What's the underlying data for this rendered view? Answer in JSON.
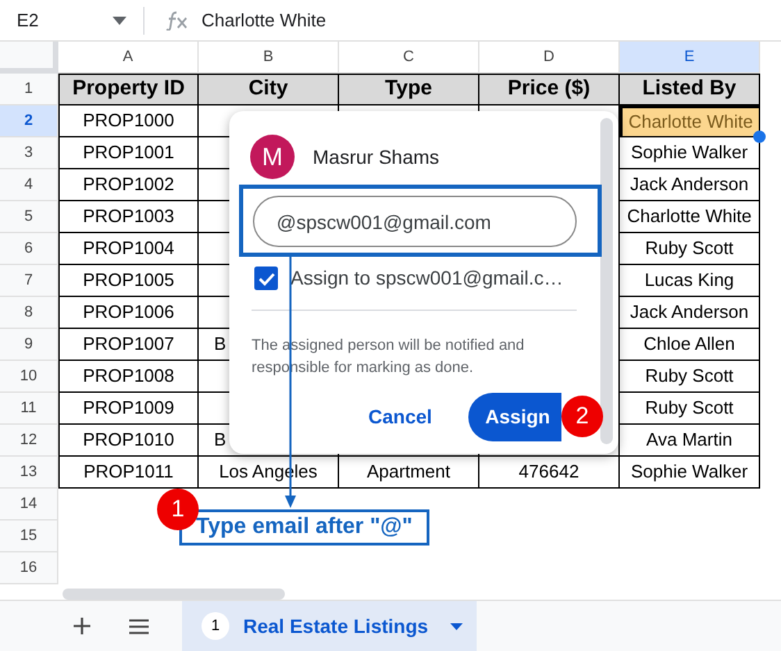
{
  "formula_bar": {
    "cell_reference": "E2",
    "formula": "Charlotte White"
  },
  "columns": [
    {
      "label": "A",
      "selected": false
    },
    {
      "label": "B",
      "selected": false
    },
    {
      "label": "C",
      "selected": false
    },
    {
      "label": "D",
      "selected": false
    },
    {
      "label": "E",
      "selected": true
    }
  ],
  "rows": [
    {
      "number": "1",
      "selected": false,
      "header": true,
      "cells": {
        "A": "Property ID",
        "B": "City",
        "C": "Type",
        "D": "Price ($)",
        "E": "Listed By"
      }
    },
    {
      "number": "2",
      "selected": true,
      "cells": {
        "A": "PROP1000",
        "E": "Charlotte White"
      }
    },
    {
      "number": "3",
      "selected": false,
      "cells": {
        "A": "PROP1001",
        "E": "Sophie Walker"
      }
    },
    {
      "number": "4",
      "selected": false,
      "cells": {
        "A": "PROP1002",
        "E": "Jack Anderson"
      }
    },
    {
      "number": "5",
      "selected": false,
      "cells": {
        "A": "PROP1003",
        "E": "Charlotte White"
      }
    },
    {
      "number": "6",
      "selected": false,
      "cells": {
        "A": "PROP1004",
        "E": "Ruby Scott"
      }
    },
    {
      "number": "7",
      "selected": false,
      "cells": {
        "A": "PROP1005",
        "E": "Lucas King"
      }
    },
    {
      "number": "8",
      "selected": false,
      "cells": {
        "A": "PROP1006",
        "E": "Jack Anderson"
      }
    },
    {
      "number": "9",
      "selected": false,
      "cells": {
        "A": "PROP1007",
        "B": "B",
        "E": "Chloe Allen"
      }
    },
    {
      "number": "10",
      "selected": false,
      "cells": {
        "A": "PROP1008",
        "E": "Ruby Scott"
      }
    },
    {
      "number": "11",
      "selected": false,
      "cells": {
        "A": "PROP1009",
        "E": "Ruby Scott"
      }
    },
    {
      "number": "12",
      "selected": false,
      "cells": {
        "A": "PROP1010",
        "B": "B",
        "E": "Ava Martin"
      }
    },
    {
      "number": "13",
      "selected": false,
      "cells": {
        "A": "PROP1011",
        "B": "Los Angeles",
        "C": "Apartment",
        "D": "476642",
        "E": "Sophie Walker"
      }
    },
    {
      "number": "14",
      "selected": false,
      "cells": {}
    },
    {
      "number": "15",
      "selected": false,
      "cells": {}
    },
    {
      "number": "16",
      "selected": false,
      "cells": {}
    }
  ],
  "assign_popup": {
    "avatar_letter": "M",
    "user_name": "Masrur Shams",
    "email_value": "@spscw001@gmail.com",
    "assign_checkbox": {
      "label": "Assign to spscw001@gmail.c…",
      "checked": true
    },
    "note": "The assigned person will be notified and responsible for marking as done.",
    "cancel_button": "Cancel",
    "assign_button": "Assign"
  },
  "annotations": [
    {
      "badge": "1",
      "text": "Type email after \"@\""
    },
    {
      "badge": "2"
    }
  ],
  "sheet_tabs": [
    {
      "badge": "1",
      "label": "Real Estate Listings",
      "selected": true
    }
  ]
}
